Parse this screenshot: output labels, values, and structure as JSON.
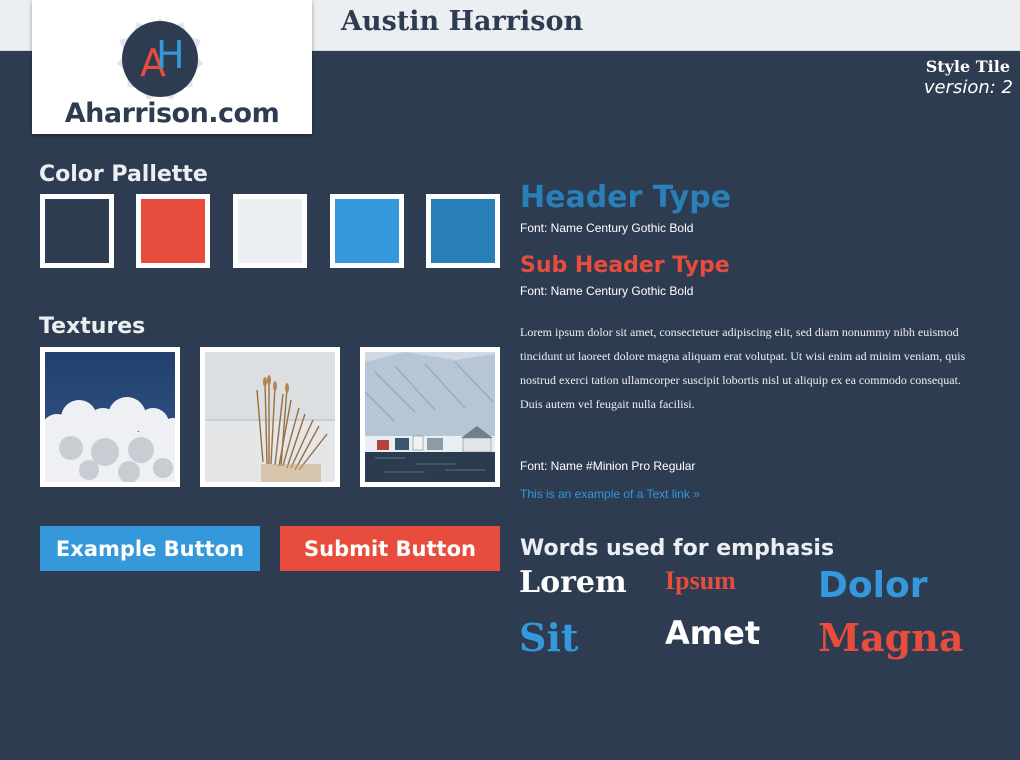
{
  "header": {
    "site_name": "Austin Harrison",
    "logo_text": "Aharrison.com",
    "logo_monogram": "AH",
    "style_tile_label": "Style Tile",
    "version_label": "version: 2"
  },
  "palette": {
    "title": "Color Pallette",
    "colors": [
      "#2e3c52",
      "#e74c3c",
      "#eceff1",
      "#3498db",
      "#2980b9"
    ]
  },
  "textures": {
    "title": "Textures",
    "items": [
      "clouds-texture",
      "reeds-texture",
      "harbor-town-texture"
    ]
  },
  "buttons": {
    "example_label": "Example Button",
    "submit_label": "Submit Button",
    "example_color": "#3498db",
    "submit_color": "#e74c3c"
  },
  "typography": {
    "header_type": "Header Type",
    "header_font_note": "Font: Name Century Gothic Bold",
    "header_color": "#2980b9",
    "subheader_type": "Sub Header Type",
    "subheader_font_note": "Font: Name Century Gothic Bold",
    "subheader_color": "#e74c3c",
    "body_copy": "Lorem ipsum dolor sit amet, consectetuer adipiscing elit, sed diam nonummy nibh euismod tincidunt ut laoreet dolore magna aliquam erat volutpat. Ut wisi enim ad minim veniam, quis nostrud exerci tation ullamcorper suscipit lobortis nisl ut aliquip ex ea commodo consequat. Duis autem vel feugait nulla facilisi.",
    "body_font_note": "Font: Name #Minion Pro Regular",
    "text_link": "This is an example of a Text link »",
    "link_color": "#3498db"
  },
  "emphasis": {
    "title": "Words used for emphasis",
    "words": [
      "Lorem",
      "Ipsum",
      "Dolor",
      "Sit",
      "Amet",
      "Magna"
    ]
  }
}
